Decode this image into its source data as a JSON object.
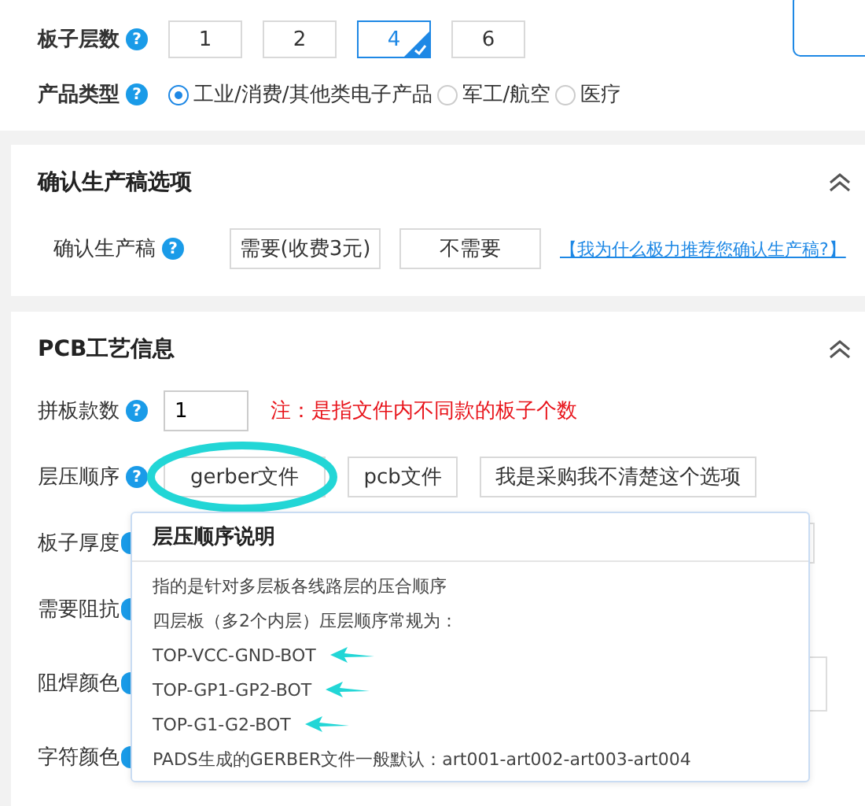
{
  "basic": {
    "rows": [
      {
        "kind": "buttons",
        "label": "板子层数",
        "help": "?",
        "options": [
          {
            "label": "1",
            "selected": false
          },
          {
            "label": "2",
            "selected": false
          },
          {
            "label": "4",
            "selected": true
          },
          {
            "label": "6",
            "selected": false
          }
        ]
      },
      {
        "kind": "radios",
        "label": "产品类型",
        "help": "?",
        "options": [
          {
            "label": "工业/消费/其他类电子产品",
            "selected": true
          },
          {
            "label": "军工/航空",
            "selected": false
          },
          {
            "label": "医疗",
            "selected": false
          }
        ]
      }
    ]
  },
  "confirm_section": {
    "title": "确认生产稿选项",
    "label": "确认生产稿",
    "help": "?",
    "options": [
      {
        "label": "需要(收费3元)",
        "selected": false
      },
      {
        "label": "不需要",
        "selected": false
      }
    ],
    "link": "【我为什么极力推荐您确认生产稿?】"
  },
  "pcb_section": {
    "title": "PCB工艺信息",
    "rows": [
      {
        "kind": "input",
        "label": "拼板款数",
        "help": "?",
        "value": "1",
        "note": "注：是指文件内不同款的板子个数"
      },
      {
        "kind": "buttons",
        "label": "层压顺序",
        "help": "?",
        "highlighted": true,
        "options": [
          {
            "label": "gerber文件",
            "selected": false
          },
          {
            "label": "pcb文件",
            "selected": false
          },
          {
            "label": "我是采购我不清楚这个选项",
            "selected": false
          }
        ]
      },
      {
        "kind": "field",
        "label": "板子厚度"
      },
      {
        "kind": "plain",
        "label": "需要阻抗"
      },
      {
        "kind": "cut",
        "label": "阻焊颜色"
      },
      {
        "kind": "plain",
        "label": "字符颜色"
      }
    ]
  },
  "popover": {
    "title": "层压顺序说明",
    "lines": [
      {
        "text": "指的是针对多层板各线路层的压合顺序",
        "arrow": false
      },
      {
        "text": "四层板（多2个内层）压层顺序常规为：",
        "arrow": false
      },
      {
        "text": "TOP-VCC-GND-BOT",
        "arrow": true
      },
      {
        "text": "TOP-GP1-GP2-BOT",
        "arrow": true
      },
      {
        "text": "TOP-G1-G2-BOT",
        "arrow": true
      },
      {
        "text": "PADS生成的GERBER文件一般默认：art001-art002-art003-art004",
        "arrow": false
      }
    ]
  }
}
